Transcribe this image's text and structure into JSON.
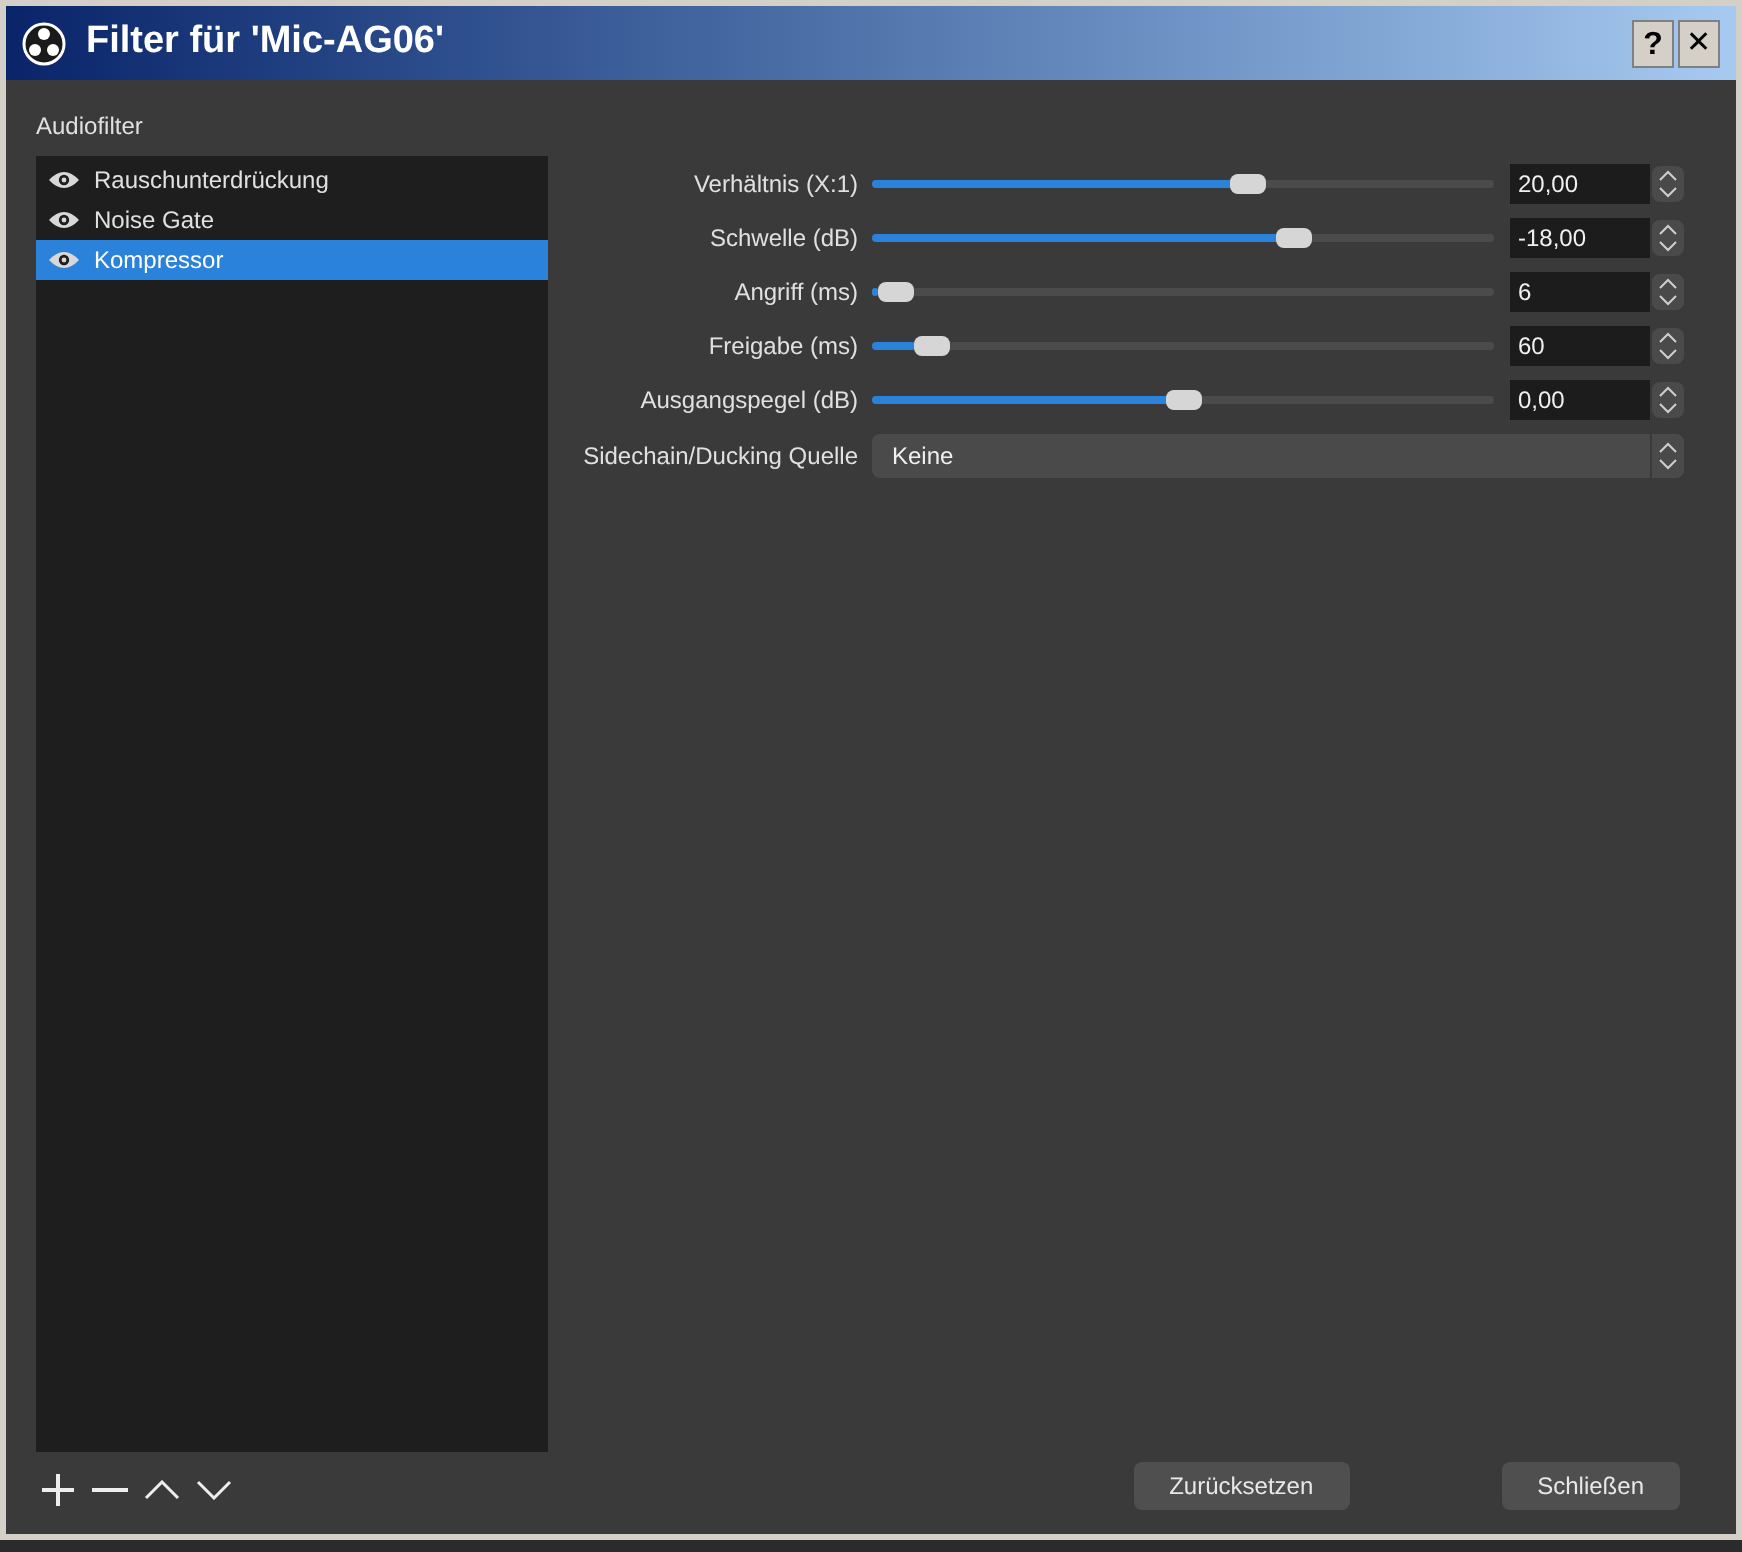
{
  "window": {
    "title": "Filter für 'Mic-AG06'",
    "help": "?",
    "close": "✕"
  },
  "filters": {
    "label": "Audiofilter",
    "items": [
      {
        "name": "Rauschunterdrückung",
        "selected": false
      },
      {
        "name": "Noise Gate",
        "selected": false
      },
      {
        "name": "Kompressor",
        "selected": true
      }
    ]
  },
  "settings": [
    {
      "kind": "slider",
      "label": "Verhältnis (X:1)",
      "level": 0.61,
      "value": "20,00"
    },
    {
      "kind": "slider",
      "label": "Schwelle (dB)",
      "level": 0.69,
      "value": "-18,00"
    },
    {
      "kind": "slider",
      "label": "Angriff (ms)",
      "level": 0.01,
      "value": "6"
    },
    {
      "kind": "slider",
      "label": "Freigabe (ms)",
      "level": 0.07,
      "value": "60"
    },
    {
      "kind": "slider",
      "label": "Ausgangspegel (dB)",
      "level": 0.5,
      "value": "0,00"
    },
    {
      "kind": "select",
      "label": "Sidechain/Ducking Quelle",
      "value": "Keine"
    }
  ],
  "buttons": [
    "Zurücksetzen",
    "Schließen"
  ]
}
